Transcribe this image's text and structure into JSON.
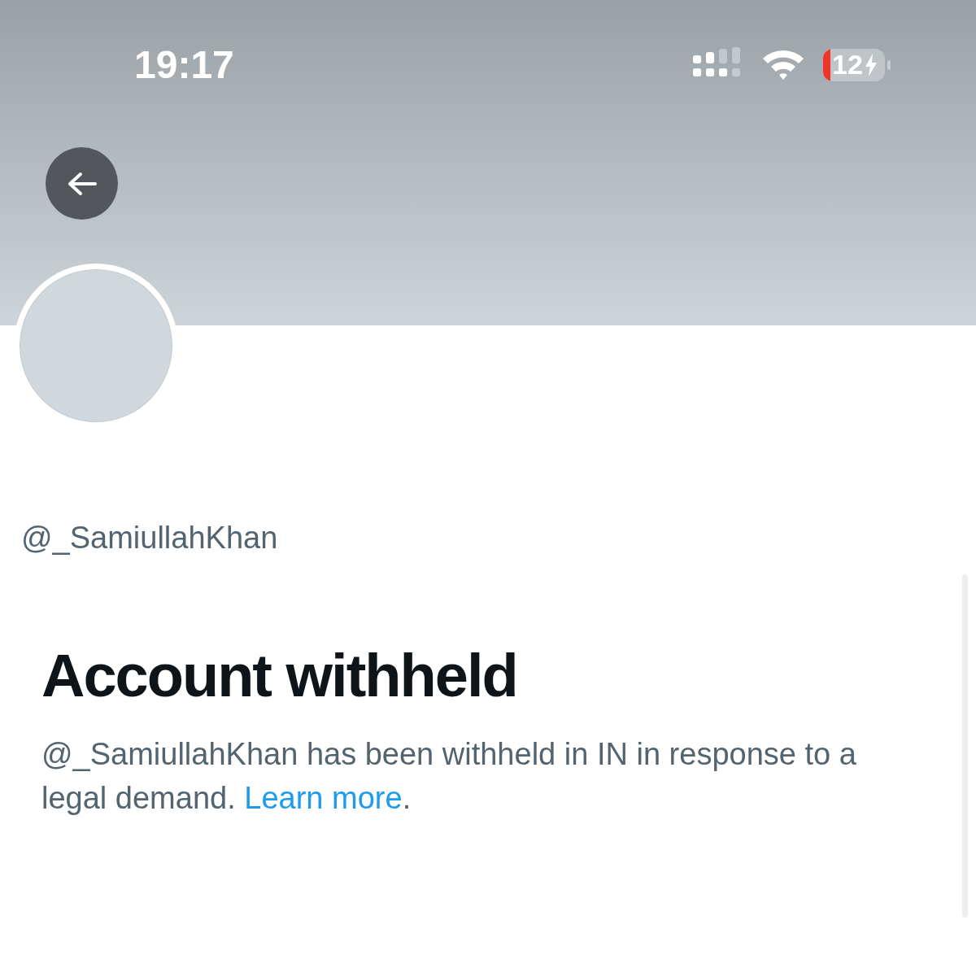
{
  "status_bar": {
    "time": "19:17",
    "battery": "12"
  },
  "profile": {
    "handle": "@_SamiullahKhan"
  },
  "notice": {
    "title": "Account withheld",
    "text": "@_SamiullahKhan has been withheld in IN in response to a legal demand. ",
    "link": "Learn more",
    "after": "."
  }
}
